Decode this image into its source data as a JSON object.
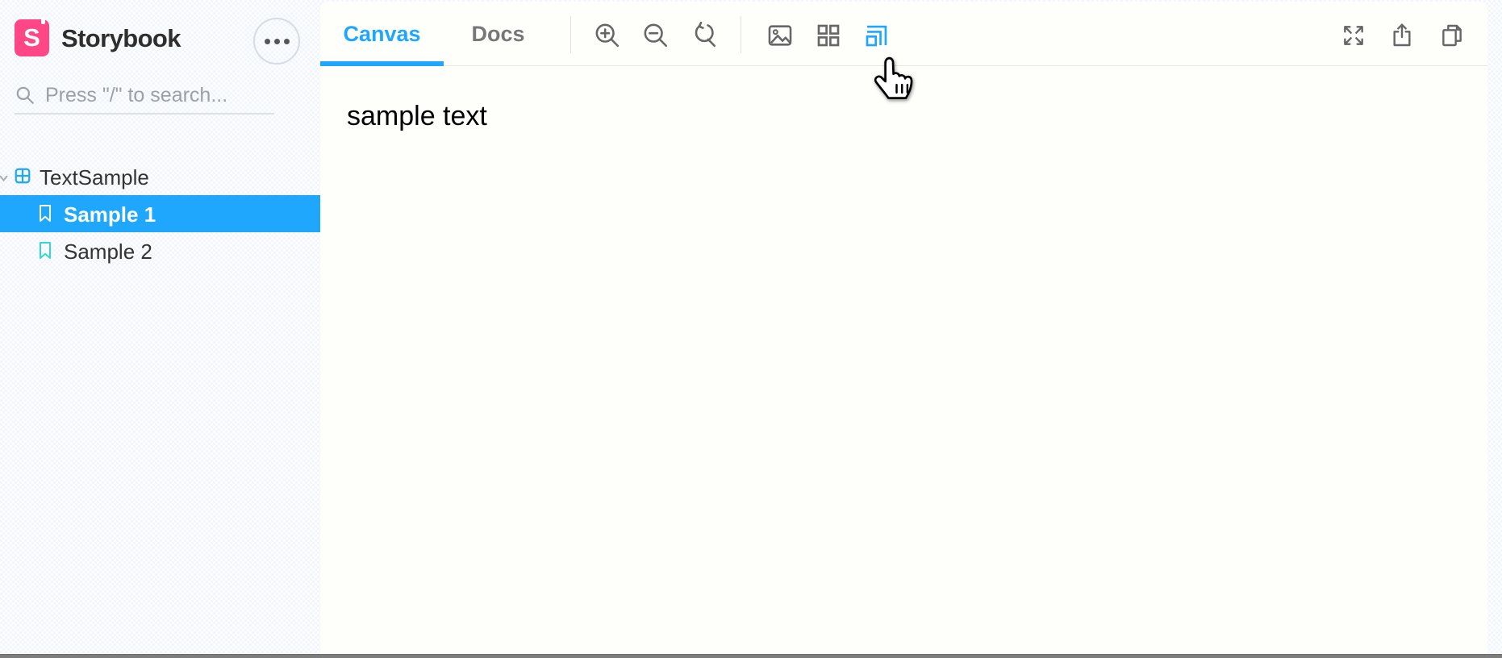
{
  "colors": {
    "accent": "#1EA7FD",
    "brand": "#FF4785",
    "story": "#37D5D3",
    "toolbar_icon": "#666666"
  },
  "app": {
    "title": "Storybook",
    "logo_letter": "S",
    "menu_button_icon": "ellipsis-icon"
  },
  "sidebar": {
    "search_placeholder": "Press \"/\" to search...",
    "tree": [
      {
        "label": "TextSample",
        "type": "component",
        "icon": "component-grid-icon",
        "expanded": true
      },
      {
        "label": "Sample 1",
        "type": "story",
        "icon": "bookmark-icon",
        "selected": true
      },
      {
        "label": "Sample 2",
        "type": "story",
        "icon": "bookmark-icon",
        "selected": false
      }
    ]
  },
  "toolbar": {
    "tabs": [
      {
        "label": "Canvas",
        "active": true
      },
      {
        "label": "Docs",
        "active": false
      }
    ],
    "zoom_tools": [
      {
        "name": "zoom-in"
      },
      {
        "name": "zoom-out"
      },
      {
        "name": "zoom-reset"
      }
    ],
    "addon_tools": [
      {
        "name": "backgrounds"
      },
      {
        "name": "grid"
      },
      {
        "name": "viewport",
        "active": true
      }
    ],
    "window_tools": [
      {
        "name": "fullscreen"
      },
      {
        "name": "share"
      },
      {
        "name": "copy-canvas-link"
      }
    ]
  },
  "canvas": {
    "content_text": "sample text"
  },
  "cursor": {
    "type": "pointing-hand"
  }
}
